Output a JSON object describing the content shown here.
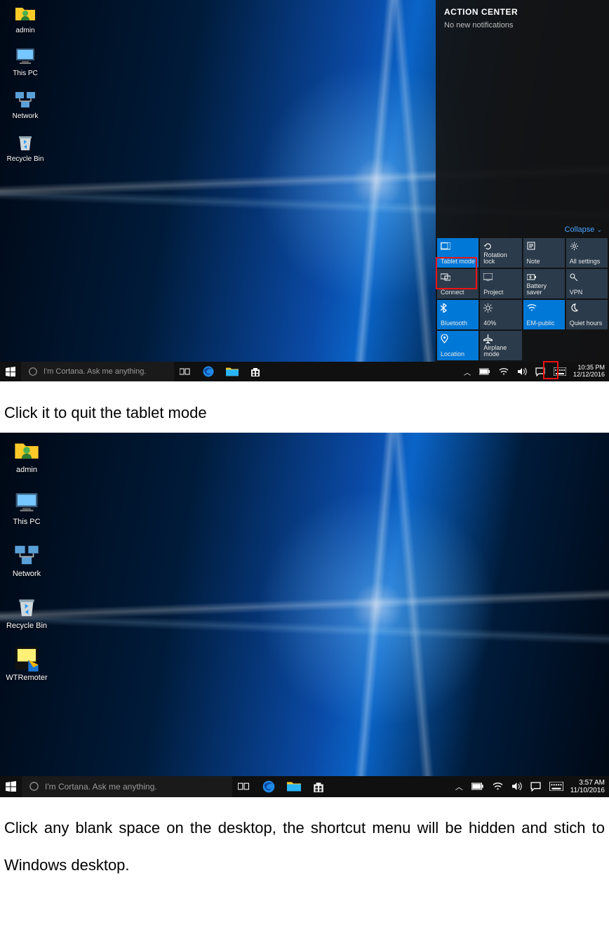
{
  "shot1": {
    "desktop_icons": [
      {
        "label": "admin",
        "name": "user-folder-icon"
      },
      {
        "label": "This PC",
        "name": "this-pc-icon"
      },
      {
        "label": "Network",
        "name": "network-icon"
      },
      {
        "label": "Recycle Bin",
        "name": "recycle-bin-icon"
      }
    ],
    "search_placeholder": "I'm Cortana. Ask me anything.",
    "tray_time": "10:35 PM",
    "tray_date": "12/12/2016",
    "action_center": {
      "title": "ACTION CENTER",
      "subtitle": "No new notifications",
      "collapse": "Collapse",
      "tiles": [
        {
          "label": "Tablet mode",
          "on": true,
          "icon": "tablet-icon",
          "highlight": true
        },
        {
          "label": "Rotation lock",
          "on": false,
          "icon": "rotation-lock-icon"
        },
        {
          "label": "Note",
          "on": false,
          "icon": "note-icon"
        },
        {
          "label": "All settings",
          "on": false,
          "icon": "settings-icon"
        },
        {
          "label": "Connect",
          "on": false,
          "icon": "connect-icon"
        },
        {
          "label": "Project",
          "on": false,
          "icon": "project-icon"
        },
        {
          "label": "Battery saver",
          "on": false,
          "icon": "battery-icon"
        },
        {
          "label": "VPN",
          "on": false,
          "icon": "vpn-icon"
        },
        {
          "label": "Bluetooth",
          "on": true,
          "icon": "bluetooth-icon"
        },
        {
          "label": "40%",
          "on": false,
          "icon": "brightness-icon"
        },
        {
          "label": "EM-public",
          "on": true,
          "icon": "wifi-icon"
        },
        {
          "label": "Quiet hours",
          "on": false,
          "icon": "moon-icon"
        },
        {
          "label": "Location",
          "on": true,
          "icon": "location-icon"
        },
        {
          "label": "Airplane mode",
          "on": false,
          "icon": "airplane-icon"
        }
      ]
    }
  },
  "caption1": "Click it to quit the tablet mode",
  "shot2": {
    "desktop_icons": [
      {
        "label": "admin",
        "name": "user-folder-icon"
      },
      {
        "label": "This PC",
        "name": "this-pc-icon"
      },
      {
        "label": "Network",
        "name": "network-icon"
      },
      {
        "label": "Recycle Bin",
        "name": "recycle-bin-icon"
      },
      {
        "label": "WTRemoter",
        "name": "wtremoter-icon"
      }
    ],
    "search_placeholder": "I'm Cortana. Ask me anything.",
    "tray_time": "3:57 AM",
    "tray_date": "11/10/2016"
  },
  "caption2": "Click any blank space on the desktop, the shortcut menu will be hidden and stich to Windows desktop."
}
